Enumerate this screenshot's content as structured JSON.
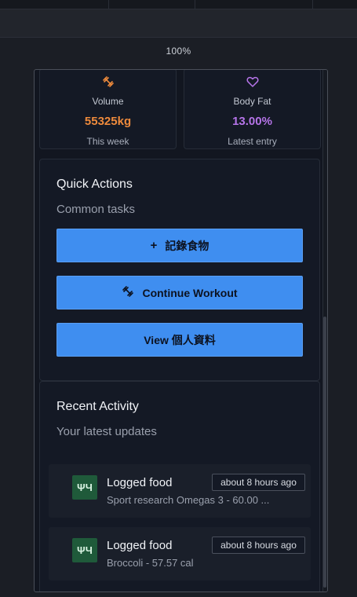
{
  "browser": {
    "zoom": "100%"
  },
  "stats": [
    {
      "label": "Volume",
      "value": "55325kg",
      "sub": "This week",
      "color": "#ee8a3c",
      "icon": "dumbbell-icon"
    },
    {
      "label": "Body Fat",
      "value": "13.00%",
      "sub": "Latest entry",
      "color": "#b574e8",
      "icon": "heart-icon"
    }
  ],
  "quick_actions": {
    "title": "Quick Actions",
    "subtitle": "Common tasks",
    "buttons": [
      {
        "label": "記錄食物",
        "icon": "plus-icon",
        "glyph": "+"
      },
      {
        "label": "Continue Workout",
        "icon": "dumbbell-icon"
      },
      {
        "label": "View 個人資料"
      }
    ]
  },
  "recent_activity": {
    "title": "Recent Activity",
    "subtitle": "Your latest updates",
    "items": [
      {
        "icon": "utensils-icon",
        "glyph": "ΨЧ",
        "title": "Logged food",
        "desc": "Sport research Omegas 3 - 60.00 ...",
        "time": "about 8 hours ago"
      },
      {
        "icon": "utensils-icon",
        "glyph": "ΨЧ",
        "title": "Logged food",
        "desc": "Broccoli - 57.57 cal",
        "time": "about 8 hours ago"
      }
    ]
  },
  "colors": {
    "accent": "#3f8ef0",
    "volume": "#ee8a3c",
    "bodyfat": "#b574e8",
    "food_badge": "#1f5a3a"
  }
}
